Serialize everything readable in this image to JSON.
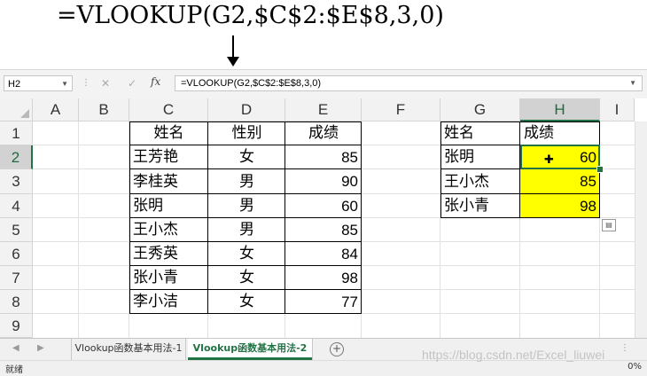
{
  "annotation": {
    "formula": "=VLOOKUP(G2,$C$2:$E$8,3,0)"
  },
  "formula_bar": {
    "name_box": "H2",
    "cancel_icon": "✕",
    "enter_icon": "✓",
    "fx_label": "fx",
    "content": "=VLOOKUP(G2,$C$2:$E$8,3,0)"
  },
  "grid": {
    "columns": [
      "A",
      "B",
      "C",
      "D",
      "E",
      "F",
      "G",
      "H",
      "I"
    ],
    "rows": [
      "1",
      "2",
      "3",
      "4",
      "5",
      "6",
      "7",
      "8",
      "9"
    ],
    "selected_cell": "H2"
  },
  "table1": {
    "headers": {
      "name": "姓名",
      "gender": "性别",
      "score": "成绩"
    },
    "rows": [
      {
        "name": "王芳艳",
        "gender": "女",
        "score": "85"
      },
      {
        "name": "李桂英",
        "gender": "男",
        "score": "90"
      },
      {
        "name": "张明",
        "gender": "男",
        "score": "60"
      },
      {
        "name": "王小杰",
        "gender": "男",
        "score": "85"
      },
      {
        "name": "王秀英",
        "gender": "女",
        "score": "84"
      },
      {
        "name": "张小青",
        "gender": "女",
        "score": "98"
      },
      {
        "name": "李小洁",
        "gender": "女",
        "score": "77"
      }
    ]
  },
  "table2": {
    "headers": {
      "name": "姓名",
      "score": "成绩"
    },
    "rows": [
      {
        "name": "张明",
        "score": "60"
      },
      {
        "name": "王小杰",
        "score": "85"
      },
      {
        "name": "张小青",
        "score": "98"
      }
    ],
    "highlight_color": "#ffff00"
  },
  "tabs": {
    "sheets": [
      "Vlookup函数基本用法-1",
      "Vlookup函数基本用法-2"
    ],
    "active_index": 1,
    "add_symbol": "+"
  },
  "status_bar": {
    "ready": "就绪",
    "zoom": "0%"
  },
  "watermark": "https://blog.csdn.net/Excel_liuwei",
  "colors": {
    "excel_green": "#217346",
    "highlight": "#ffff00"
  }
}
